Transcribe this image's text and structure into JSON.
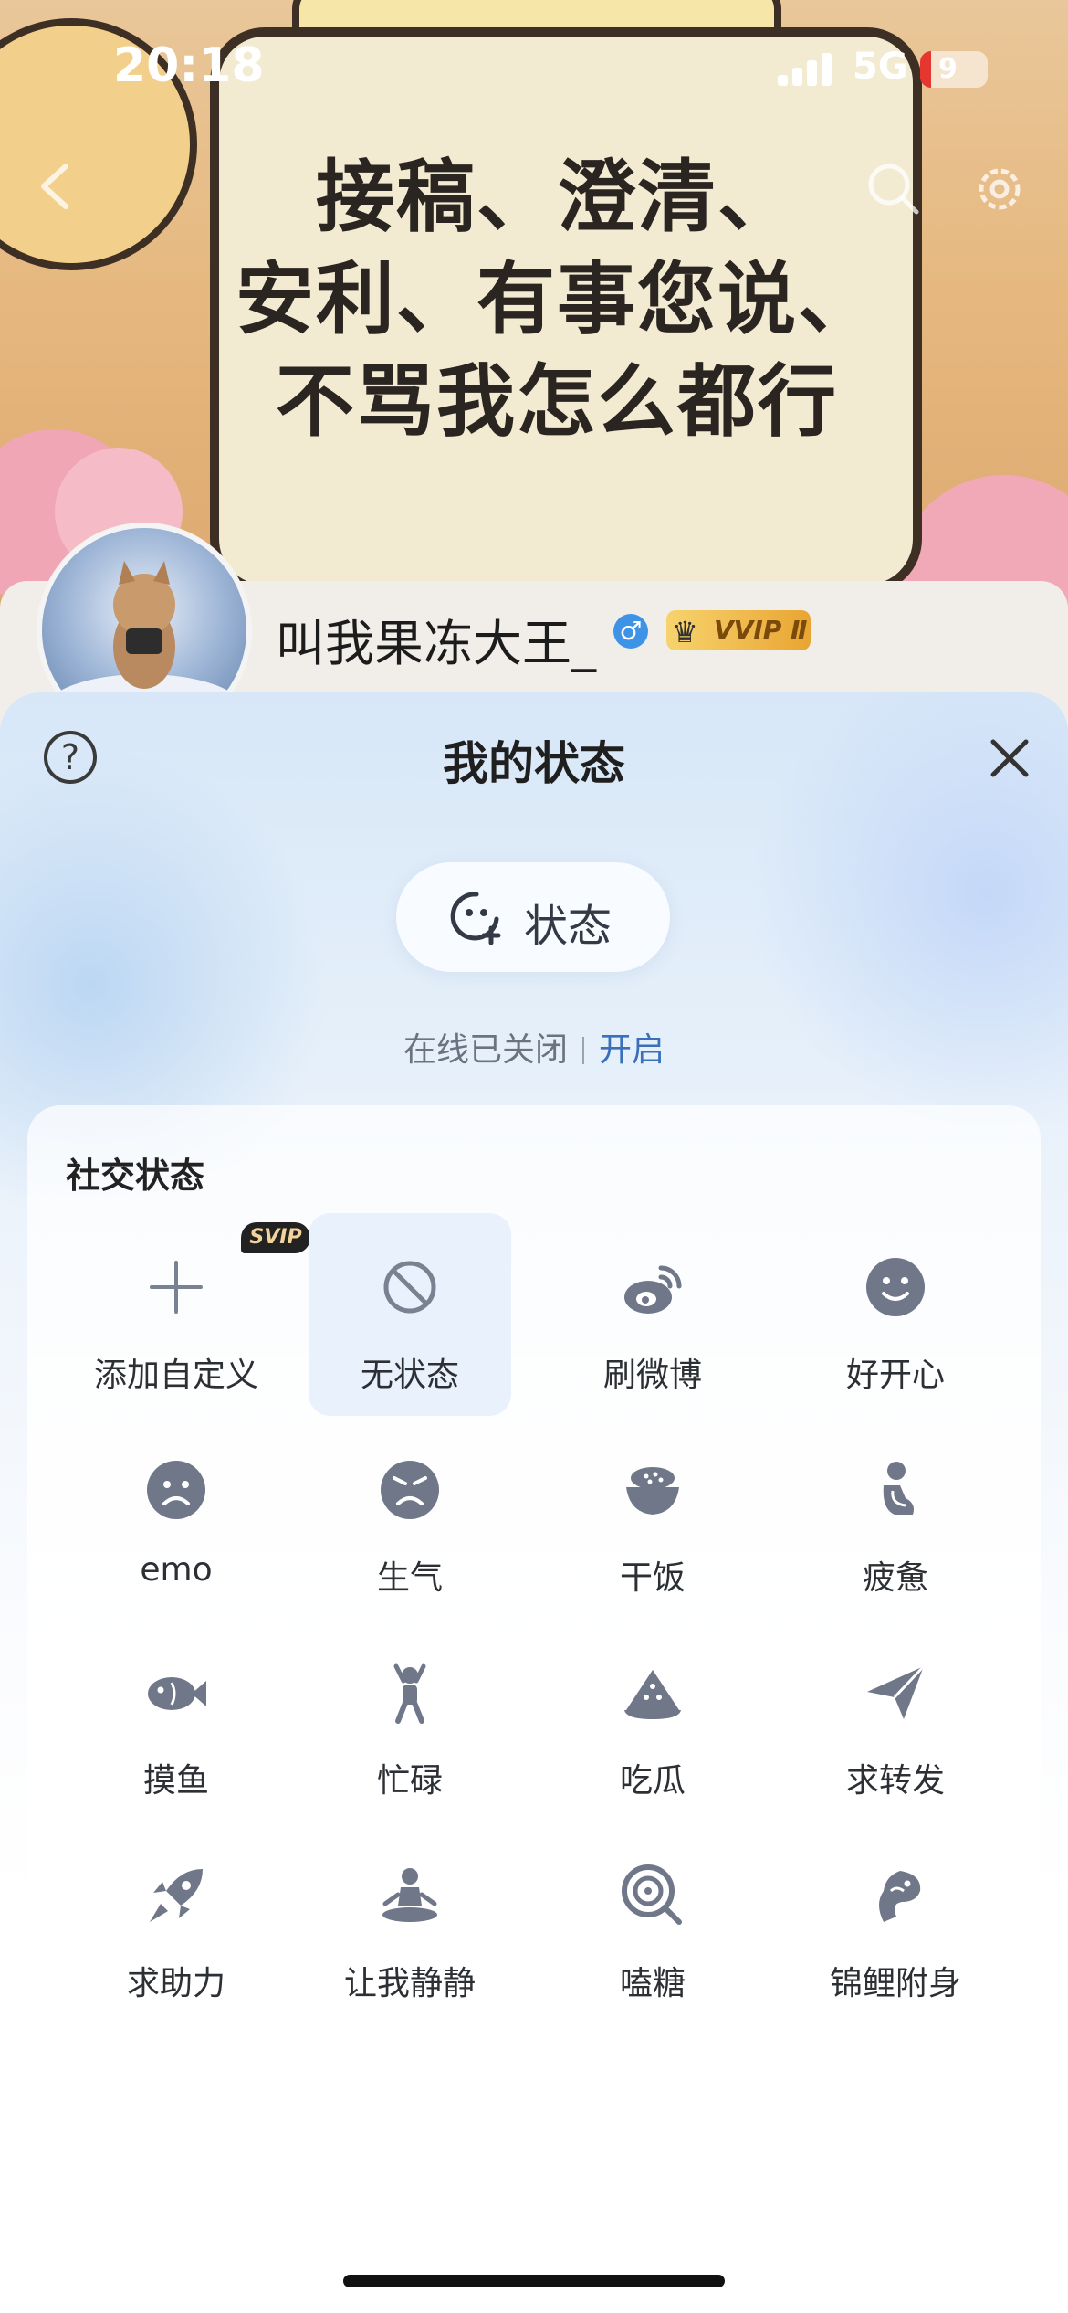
{
  "status_bar": {
    "time": "20:18",
    "network": "5G",
    "battery_level": "9"
  },
  "profile": {
    "poster_lines": [
      "接稿、澄清、",
      "安利、有事您说、",
      "不骂我怎么都行"
    ],
    "username": "叫我果冻大王_",
    "gender_symbol": "♂",
    "vip_label": "VVIP Ⅱ"
  },
  "sheet": {
    "title": "我的状态",
    "help_symbol": "?",
    "status_button_label": "状态",
    "online_status_text": "在线已关闭",
    "online_action": "开启",
    "section_title": "社交状态",
    "svip_badge": "SVIP",
    "items": [
      {
        "label": "添加自定义",
        "icon": "plus-icon"
      },
      {
        "label": "无状态",
        "icon": "no-status-icon"
      },
      {
        "label": "刷微博",
        "icon": "weibo-icon"
      },
      {
        "label": "好开心",
        "icon": "happy-face-icon"
      },
      {
        "label": "emo",
        "icon": "sad-face-icon"
      },
      {
        "label": "生气",
        "icon": "angry-face-icon"
      },
      {
        "label": "干饭",
        "icon": "rice-bowl-icon"
      },
      {
        "label": "疲惫",
        "icon": "tired-person-icon"
      },
      {
        "label": "摸鱼",
        "icon": "fish-icon"
      },
      {
        "label": "忙碌",
        "icon": "busy-person-icon"
      },
      {
        "label": "吃瓜",
        "icon": "watermelon-icon"
      },
      {
        "label": "求转发",
        "icon": "paper-plane-icon"
      },
      {
        "label": "求助力",
        "icon": "rocket-icon"
      },
      {
        "label": "让我静静",
        "icon": "meditation-icon"
      },
      {
        "label": "嗑糖",
        "icon": "lollipop-icon"
      },
      {
        "label": "锦鲤附身",
        "icon": "koi-icon"
      }
    ]
  },
  "colors": {
    "accent": "#3a6fb9",
    "icon": "#6f7789",
    "selected_bg": "#e8f1fc"
  }
}
